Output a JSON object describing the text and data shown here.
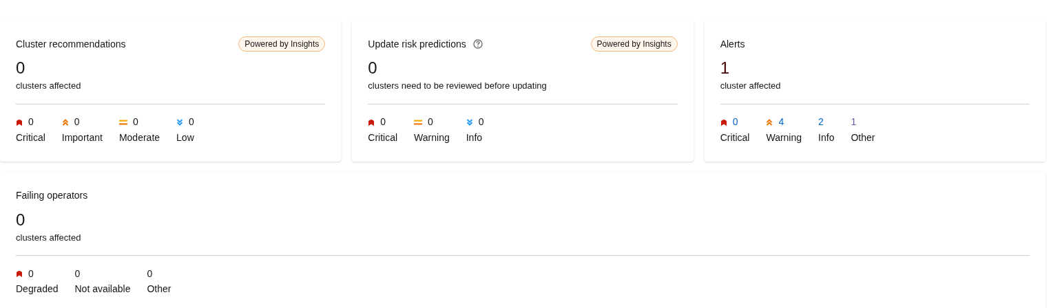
{
  "cards": [
    {
      "title": "Cluster recommendations",
      "help": false,
      "badge": "Powered by Insights",
      "value": "0",
      "color": "#151515",
      "subtitle": "clusters affected",
      "counts": [
        {
          "kind": "critical",
          "count": "0",
          "label": "Critical",
          "color": "#151515"
        },
        {
          "kind": "important",
          "count": "0",
          "label": "Important",
          "color": "#151515"
        },
        {
          "kind": "moderate",
          "count": "0",
          "label": "Moderate",
          "color": "#151515"
        },
        {
          "kind": "low",
          "count": "0",
          "label": "Low",
          "color": "#151515"
        }
      ]
    },
    {
      "title": "Update risk predictions",
      "help": true,
      "badge": "Powered by Insights",
      "value": "0",
      "color": "#151515",
      "subtitle": "clusters need to be reviewed before updating",
      "counts": [
        {
          "kind": "critical",
          "count": "0",
          "label": "Critical",
          "color": "#151515"
        },
        {
          "kind": "moderate",
          "count": "0",
          "label": "Warning",
          "color": "#151515"
        },
        {
          "kind": "low",
          "count": "0",
          "label": "Info",
          "color": "#151515"
        }
      ]
    },
    {
      "title": "Alerts",
      "help": false,
      "value": "1",
      "color": "#470000",
      "subtitle": "cluster affected",
      "counts": [
        {
          "kind": "critical",
          "count": "0",
          "label": "Critical",
          "color": "#0066cc"
        },
        {
          "kind": "important",
          "count": "4",
          "label": "Warning",
          "color": "#0066cc"
        },
        {
          "kind": "none",
          "count": "2",
          "label": "Info",
          "color": "#0066cc"
        },
        {
          "kind": "none",
          "count": "1",
          "label": "Other",
          "color": "#6753ac"
        }
      ]
    },
    {
      "title": "Failing operators",
      "help": false,
      "value": "0",
      "color": "#151515",
      "subtitle": "clusters affected",
      "counts": [
        {
          "kind": "critical",
          "count": "0",
          "label": "Degraded",
          "color": "#151515"
        },
        {
          "kind": "none",
          "count": "0",
          "label": "Not available",
          "color": "#151515"
        },
        {
          "kind": "none",
          "count": "0",
          "label": "Other",
          "color": "#151515"
        }
      ]
    }
  ]
}
